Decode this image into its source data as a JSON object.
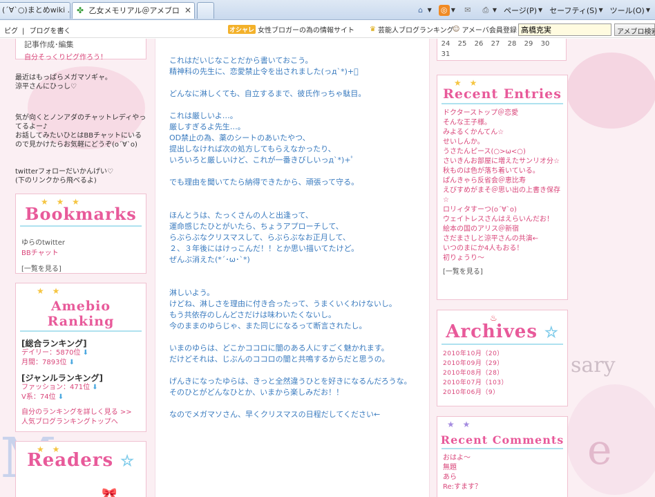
{
  "tabs": [
    {
      "title": "(´∀`○)まとめwiki ..."
    },
    {
      "title": "乙女メモリアル＠アメブロ"
    }
  ],
  "commandbar": {
    "page": "ページ(P)",
    "safety": "セーフティ(S)",
    "tools": "ツール(O)"
  },
  "ameba": {
    "links": [
      "ピグ",
      "ブログを書く"
    ],
    "oshare_badge": "オシャレ",
    "women_blogger": "女性ブロガーの為の情報サイト",
    "celebrity": "芸能人ブログランキング",
    "member": "アメーバ会員登録",
    "search_value": "高橋克実",
    "search_button": "アメブロ検索"
  },
  "left": {
    "profile": {
      "line1": "記事作成･編集",
      "line2": "自分そっくりピグ作ろう！"
    },
    "msg1": [
      "最近はもっぱらメガマソギャ。",
      "涼平さんにひっし♡"
    ],
    "msg2": [
      "気が向くとノンアダのチャットレディやってるよー♪",
      "お話してみたいひとはBBチャットにいるので見かけたらお気軽にどうぞ(o´∀`o)"
    ],
    "msg3": [
      "twitterフォローだいかんげい♡",
      "(下のリンクから飛べるよ)"
    ],
    "bookmarks": {
      "title": "Bookmarks",
      "links": [
        "ゆらのtwitter",
        "BBチャット"
      ],
      "more": "[一覧を見る]"
    },
    "ranking": {
      "title": "Amebio Ranking",
      "overall_head": "[総合ランキング]",
      "daily": "デイリー：5870位",
      "monthly": "月間：7893位",
      "genre_head": "[ジャンルランキング]",
      "fashion": "ファッション：471位",
      "vkei": "V系：74位",
      "more1": "自分のランキングを詳しく見る >>",
      "more2": "人気ブログランキングトップへ"
    },
    "readers": {
      "title": "Readers"
    }
  },
  "post": {
    "paragraphs": [
      [
        "これはだいじなことだから書いておこう。",
        "精神科の先生に、恋愛禁止令を出されました(っд`*)+ﾟ"
      ],
      [
        "どんなに淋しくても、自立するまで、彼氏作っちゃ駄目。"
      ],
      [
        "これは厳しいよ…。",
        "厳しすぎるよ先生…。",
        "OD禁止の為、薬のシートのあいたやつ、",
        "提出しなければ次の処方してもらえなかったり、",
        "いろいろと厳しいけど、これが一番きびしいっд`*)+ﾟ"
      ],
      [
        "でも理由を聞いてたら納得できたから、頑張って守る。"
      ],
      [
        ""
      ],
      [
        "ほんとうは、たっくさんの人と出逢って、",
        "運命感じたひとがいたら、ちょうアプローチして、",
        "らぶらぶなクリスマスして、らぶらぶなお正月して、",
        "２、３年後にはけっこんだ！！とか思い描いてたけど。",
        "ぜんぶ消えた(*´･ω･`*)"
      ],
      [
        ""
      ],
      [
        "淋しいよう。",
        "けどね、淋しさを理由に付き合ったって、うまくいくわけないし。",
        "もう共依存のしんどさだけは味わいたくないし。",
        "今のままのゆらじゃ、また同じになるって断言されたし。"
      ],
      [
        "いまのゆらは、どこかココロに闇のある人にすごく魅かれます。",
        "だけどそれは、じぶんのココロの闇と共鳴するからだと思うの。"
      ],
      [
        "げんきになったゆらは、きっと全然違うひとを好きになるんだろうな。",
        "そのひとがどんなひとか、いまから楽しみだお！！"
      ],
      [
        "なのでメガマソさん、早くクリスマスの日程だしてください←"
      ]
    ]
  },
  "right": {
    "calendar": {
      "row1": [
        "24",
        "25",
        "26",
        "27",
        "28",
        "29",
        "30"
      ],
      "row2": [
        "31"
      ]
    },
    "recent_entries": {
      "title": "Recent Entries",
      "items": [
        "ドクターストップ＠恋愛",
        "そんな王子様。",
        "みよるくかんてん☆",
        "せいしんか。",
        "うさたんピース(○>ω<○)",
        "さいきんお部屋に増えたサンリオ分☆",
        "秋ものは色が落ち着いている。",
        "ぱんきゃら反省会＠恵比寿",
        "えびすめがまそ＠思い出の上書き保存☆",
        "ロリィタすーつ(o´∀`o)",
        "ウェイトレスさんはえらいんだお！",
        "絵本の国のアリス＠新宿",
        "さだまさしと涼平さんの共演←",
        "いつのまにか4人もおる！",
        "初りょうり～"
      ],
      "more": "[一覧を見る]"
    },
    "archives": {
      "title": "Archives",
      "items": [
        "2010年10月（20）",
        "2010年09月（29）",
        "2010年08月（28）",
        "2010年07月（103）",
        "2010年06月（9）"
      ]
    },
    "recent_comments": {
      "title": "Recent Comments",
      "items": [
        "おはよ～",
        "無題",
        "あら",
        "Re:すます？"
      ]
    }
  },
  "bg": {
    "anniversary": "sary",
    "logo_e": "e",
    "logo_m": "M"
  },
  "colors": {
    "accent_pink": "#d9467a",
    "post_blue": "#3a7bbf",
    "bg_pink": "#fbeff3"
  }
}
